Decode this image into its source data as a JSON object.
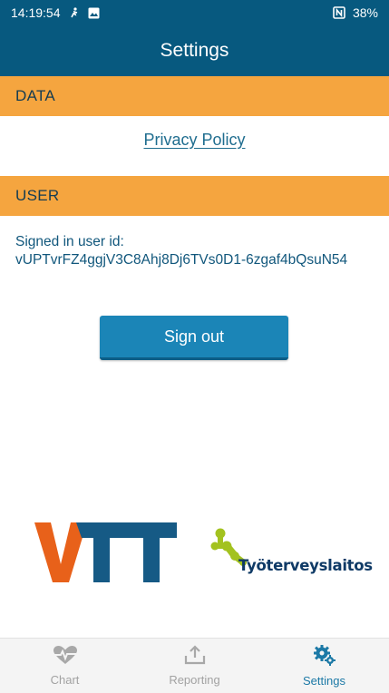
{
  "status_bar": {
    "time": "14:19:54",
    "battery": "38%",
    "icons": [
      "activity-icon",
      "image-icon",
      "nfc-icon",
      "battery-icon"
    ]
  },
  "app_bar": {
    "title": "Settings"
  },
  "sections": {
    "data": {
      "header": "DATA",
      "privacy_link": "Privacy Policy"
    },
    "user": {
      "header": "USER",
      "user_id_label": "Signed in user id:",
      "user_id": "vUPTvrFZ4ggjV3C8Ahj8Dj6TVs0D1-6zgaf4bQsuN54",
      "sign_out_label": "Sign out"
    }
  },
  "logos": {
    "vtt": "VTT",
    "ttl": "Työterveyslaitos"
  },
  "bottom_nav": {
    "items": [
      {
        "label": "Chart",
        "icon": "heart-pulse-icon"
      },
      {
        "label": "Reporting",
        "icon": "upload-icon"
      },
      {
        "label": "Settings",
        "icon": "gears-icon"
      }
    ],
    "active": "Settings"
  },
  "colors": {
    "primary": "#07597f",
    "section_header": "#f5a53f",
    "button": "#1b85b7",
    "active_nav": "#1c79a6",
    "vtt_orange": "#e8611a",
    "vtt_blue": "#165a85",
    "ttl_green": "#a3c21f"
  }
}
